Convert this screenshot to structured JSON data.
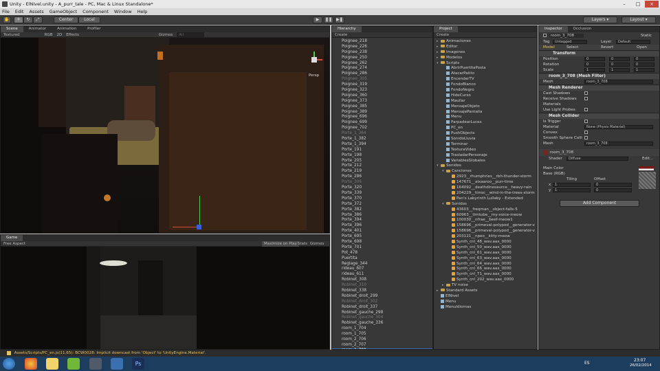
{
  "window": {
    "title": "Unity - ElNivel.unity - A_purr_tale - PC, Mac & Linux Standalone*"
  },
  "menu": [
    "File",
    "Edit",
    "Assets",
    "GameObject",
    "Component",
    "Window",
    "Help"
  ],
  "toolbar": {
    "pivot": "Center",
    "space": "Local",
    "layers": "Layers",
    "layout": "Layout"
  },
  "scene": {
    "tabs": [
      "Scene",
      "Animator",
      "Animation",
      "Profiler"
    ],
    "render_mode": "Textured",
    "color_mode": "RGB",
    "mode_2d": "2D",
    "effects": "Effects",
    "gizmos": "Gizmos",
    "search_placeholder": "All",
    "persp": "Persp"
  },
  "game": {
    "tab": "Game",
    "aspect": "Free Aspect",
    "maximize": "Maximize on Play",
    "stats": "Stats",
    "gizmos": "Gizmos"
  },
  "hierarchy": {
    "tab": "Hierarchy",
    "create": "Create",
    "items": [
      {
        "name": "Poignee_218",
        "dim": false
      },
      {
        "name": "Poignee_226",
        "dim": false
      },
      {
        "name": "Poignee_238",
        "dim": false
      },
      {
        "name": "Poignee_250",
        "dim": false
      },
      {
        "name": "Poignee_262",
        "dim": false
      },
      {
        "name": "Poignee_274",
        "dim": false
      },
      {
        "name": "Poignee_286",
        "dim": false
      },
      {
        "name": "Poignee_305",
        "dim": true
      },
      {
        "name": "Poignee_319",
        "dim": false
      },
      {
        "name": "Poignee_323",
        "dim": false
      },
      {
        "name": "Poignee_360",
        "dim": false
      },
      {
        "name": "Poignee_373",
        "dim": false
      },
      {
        "name": "Poignee_385",
        "dim": false
      },
      {
        "name": "Poignee_389",
        "dim": false
      },
      {
        "name": "Poignee_696",
        "dim": false
      },
      {
        "name": "Poignee_699",
        "dim": false
      },
      {
        "name": "Poignee_702",
        "dim": false
      },
      {
        "name": "Porte_1_364",
        "dim": true
      },
      {
        "name": "Porte_1_382",
        "dim": false
      },
      {
        "name": "Porte_1_394",
        "dim": false
      },
      {
        "name": "Porte_191",
        "dim": false
      },
      {
        "name": "Porte_198",
        "dim": false
      },
      {
        "name": "Porte_205",
        "dim": false
      },
      {
        "name": "Porte_212",
        "dim": false
      },
      {
        "name": "Porte_219",
        "dim": false
      },
      {
        "name": "Porte_286",
        "dim": false
      },
      {
        "name": "Porte_306",
        "dim": true
      },
      {
        "name": "Porte_320",
        "dim": false
      },
      {
        "name": "Porte_339",
        "dim": false
      },
      {
        "name": "Porte_370",
        "dim": false
      },
      {
        "name": "Porte_372",
        "dim": false
      },
      {
        "name": "Porte_382",
        "dim": false
      },
      {
        "name": "Porte_386",
        "dim": false
      },
      {
        "name": "Porte_394",
        "dim": false
      },
      {
        "name": "Porte_396",
        "dim": false
      },
      {
        "name": "Porte_401",
        "dim": false
      },
      {
        "name": "Porte_695",
        "dim": false
      },
      {
        "name": "Porte_698",
        "dim": false
      },
      {
        "name": "Porte_701",
        "dim": false
      },
      {
        "name": "Pot_478",
        "dim": false
      },
      {
        "name": "Puertita",
        "dim": false
      },
      {
        "name": "Reglage_344",
        "dim": false
      },
      {
        "name": "rideau_607",
        "dim": false
      },
      {
        "name": "rideau_611",
        "dim": false
      },
      {
        "name": "Robinet_308",
        "dim": false
      },
      {
        "name": "Robinet_310",
        "dim": true
      },
      {
        "name": "Robinet_338",
        "dim": false
      },
      {
        "name": "Robinet_droit_299",
        "dim": false
      },
      {
        "name": "Robinet_droit_302",
        "dim": true
      },
      {
        "name": "Robinet_droit_337",
        "dim": false
      },
      {
        "name": "Robinet_gauche_298",
        "dim": false
      },
      {
        "name": "Robinet_gauche_304",
        "dim": true
      },
      {
        "name": "Robinet_gauche_336",
        "dim": false
      },
      {
        "name": "room_1_704",
        "dim": false
      },
      {
        "name": "room_1_705",
        "dim": false
      },
      {
        "name": "room_2_706",
        "dim": false
      },
      {
        "name": "room_2_707",
        "dim": false
      },
      {
        "name": "room_3_708",
        "dim": false,
        "selected": true
      }
    ]
  },
  "project": {
    "tab": "Project",
    "create": "Create",
    "items": [
      {
        "t": "folder",
        "d": 0,
        "name": "Animaciones"
      },
      {
        "t": "folder",
        "d": 0,
        "name": "Editor"
      },
      {
        "t": "folder",
        "d": 0,
        "name": "Imagenes"
      },
      {
        "t": "folder",
        "d": 0,
        "name": "Modelos"
      },
      {
        "t": "folder",
        "d": 0,
        "name": "Scripts",
        "open": true
      },
      {
        "t": "script",
        "d": 1,
        "name": "AbrirPuertitaPosta"
      },
      {
        "t": "script",
        "d": 1,
        "name": "AtacarPatito"
      },
      {
        "t": "script",
        "d": 1,
        "name": "EncenderTV"
      },
      {
        "t": "script",
        "d": 1,
        "name": "FondoBlanco"
      },
      {
        "t": "script",
        "d": 1,
        "name": "FondoNegro"
      },
      {
        "t": "script",
        "d": 1,
        "name": "HideCurso"
      },
      {
        "t": "script",
        "d": 1,
        "name": "Maullar"
      },
      {
        "t": "script",
        "d": 1,
        "name": "MensajeObjeto"
      },
      {
        "t": "script",
        "d": 1,
        "name": "MensajePantalla"
      },
      {
        "t": "script",
        "d": 1,
        "name": "Menu"
      },
      {
        "t": "script",
        "d": 1,
        "name": "ParpadearLuces"
      },
      {
        "t": "script",
        "d": 1,
        "name": "PC_en"
      },
      {
        "t": "script",
        "d": 1,
        "name": "PushObjects"
      },
      {
        "t": "script",
        "d": 1,
        "name": "SonidoLluvia"
      },
      {
        "t": "script",
        "d": 1,
        "name": "Terminar"
      },
      {
        "t": "script",
        "d": 1,
        "name": "TexturaVideo"
      },
      {
        "t": "script",
        "d": 1,
        "name": "TrasladarPersonaje"
      },
      {
        "t": "script",
        "d": 1,
        "name": "VariablesGlobales"
      },
      {
        "t": "folder",
        "d": 0,
        "name": "Sonidos",
        "open": true
      },
      {
        "t": "folder",
        "d": 1,
        "name": "Canciones",
        "open": true
      },
      {
        "t": "sound",
        "d": 2,
        "name": "2923__rhumphries__rbh-thunder-storm"
      },
      {
        "t": "sound",
        "d": 2,
        "name": "147671__aixaaroo__purr-time"
      },
      {
        "t": "sound",
        "d": 2,
        "name": "164092__deathdinosaurce__heavy-rain"
      },
      {
        "t": "sound",
        "d": 2,
        "name": "204229__timsc__wind-in-the-trees-storm"
      },
      {
        "t": "sound",
        "d": 2,
        "name": "Pan's Labyrinth Lullaby - Extended"
      },
      {
        "t": "folder",
        "d": 1,
        "name": "Sonidos",
        "open": true
      },
      {
        "t": "sound",
        "d": 2,
        "name": "43603__freqman__object-falls-5"
      },
      {
        "t": "sound",
        "d": 2,
        "name": "60963__timtube__my-voice-meow"
      },
      {
        "t": "sound",
        "d": 2,
        "name": "100030__nfrae__beef-meow1"
      },
      {
        "t": "sound",
        "d": 2,
        "name": "158696__primeval-polypod__generator-v"
      },
      {
        "t": "sound",
        "d": 2,
        "name": "158696__primeval-polypod__generator-v"
      },
      {
        "t": "sound",
        "d": 2,
        "name": "203121__npeo__kitty-meow"
      },
      {
        "t": "sound",
        "d": 2,
        "name": "Synth_cnl_48_wav.aax_0000"
      },
      {
        "t": "sound",
        "d": 2,
        "name": "Synth_cnl_50_wav.aax_0000"
      },
      {
        "t": "sound",
        "d": 2,
        "name": "Synth_cnl_61_wav.aax_0000"
      },
      {
        "t": "sound",
        "d": 2,
        "name": "Synth_cnl_63_wav.aax_0000"
      },
      {
        "t": "sound",
        "d": 2,
        "name": "Synth_cnl_64_wav.aax_0000"
      },
      {
        "t": "sound",
        "d": 2,
        "name": "Synth_cnl_66_wav.aax_0000"
      },
      {
        "t": "sound",
        "d": 2,
        "name": "Synth_cnl_71_wav.aax_0000"
      },
      {
        "t": "sound",
        "d": 2,
        "name": "Synth_cnl_202_wav.aax_0000"
      },
      {
        "t": "folder",
        "d": 1,
        "name": "TV noise"
      },
      {
        "t": "folder",
        "d": 0,
        "name": "Standard Assets"
      },
      {
        "t": "scene",
        "d": 0,
        "name": "ElNivel"
      },
      {
        "t": "scene",
        "d": 0,
        "name": "Menu"
      },
      {
        "t": "scene",
        "d": 0,
        "name": "MenuIdiomas"
      }
    ]
  },
  "inspector": {
    "tabs": [
      "Inspector",
      "Occlusion"
    ],
    "object_name": "room_3_708",
    "static": "Static",
    "tag_label": "Tag",
    "tag": "Untagged",
    "layer_label": "Layer",
    "layer": "Default",
    "model_label": "Model",
    "select": "Select",
    "revert": "Revert",
    "open": "Open",
    "transform": {
      "title": "Transform",
      "rows": [
        {
          "label": "Position",
          "x": "0",
          "y": "0",
          "z": "0"
        },
        {
          "label": "Rotation",
          "x": "0",
          "y": "0",
          "z": "0"
        },
        {
          "label": "Scale",
          "x": "1",
          "y": "1",
          "z": "1"
        }
      ]
    },
    "mesh_filter": {
      "title": "room_3_708 (Mesh Filter)",
      "label": "Mesh",
      "value": "room_3_708"
    },
    "mesh_renderer": {
      "title": "Mesh Renderer",
      "cast": "Cast Shadows",
      "receive": "Receive Shadows",
      "materials": "Materials",
      "probes": "Use Light Probes"
    },
    "mesh_collider": {
      "title": "Mesh Collider",
      "trigger": "Is Trigger",
      "material": "Material",
      "material_value": "None (Physic Material)",
      "convex": "Convex",
      "smooth": "Smooth Sphere Colli",
      "mesh": "Mesh",
      "mesh_value": "room_3_708"
    },
    "material": {
      "name": "room_3_708",
      "shader_label": "Shader",
      "shader": "Diffuse",
      "edit": "Edit...",
      "main_color": "Main Color",
      "base": "Base (RGB)",
      "tiling": "Tiling",
      "offset": "Offset",
      "x_label": "x",
      "y_label": "y",
      "tile_x": "1",
      "tile_y": "1",
      "off_x": "0",
      "off_y": "0",
      "select": "Select"
    },
    "add_component": "Add Component"
  },
  "status": {
    "message": "Assets/Scripts/PC_en.js(11,65): BCW0028: Implicit downcast from 'Object' to 'UnityEngine.Material'."
  },
  "taskbar": {
    "lang": "ES",
    "time": "23:07",
    "date": "26/02/2014"
  },
  "colors": {
    "accent": "#3d6fae",
    "panel": "#383838",
    "taskbar": "#1d3d5f"
  }
}
